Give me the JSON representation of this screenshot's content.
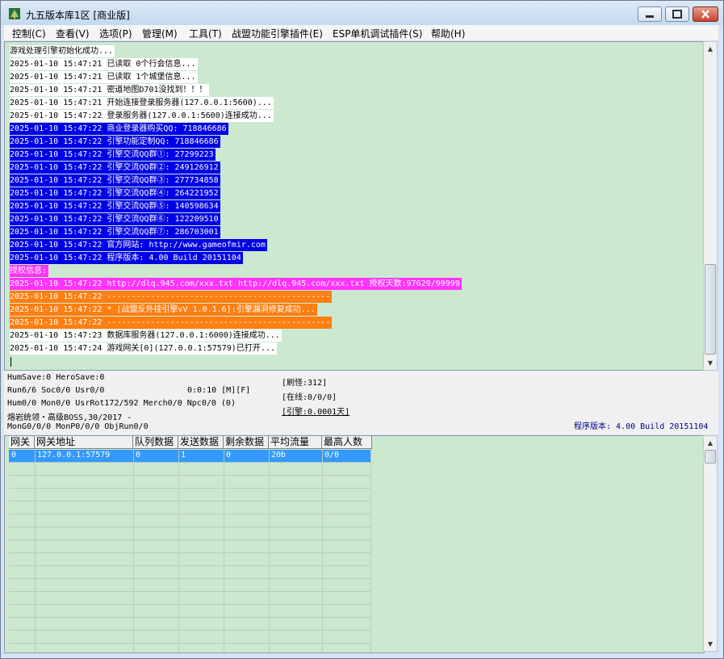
{
  "window": {
    "title": "九五版本库1区 [商业版]",
    "buttons": [
      "minimize-icon",
      "maximize-icon",
      "close-icon"
    ]
  },
  "menu": [
    "控制(C)",
    "查看(V)",
    "选项(P)",
    "管理(M)",
    "工具(T)",
    "战盟功能引擎插件(E)",
    "ESP单机调试插件(S)",
    "帮助(H)"
  ],
  "log": [
    {
      "text": "游戏处理引擎初始化成功...",
      "style": "white"
    },
    {
      "text": "2025-01-10 15:47:21 已读取 0个行会信息...",
      "style": "white"
    },
    {
      "text": "2025-01-10 15:47:21 已读取 1个城堡信息...",
      "style": "white"
    },
    {
      "text": "2025-01-10 15:47:21 密道地图D701没找到！！！",
      "style": "white"
    },
    {
      "text": "2025-01-10 15:47:21 开始连接登录服务器(127.0.0.1:5600)...",
      "style": "white"
    },
    {
      "text": "2025-01-10 15:47:22 登录服务器(127.0.0.1:5600)连接成功...",
      "style": "white"
    },
    {
      "text": "2025-01-10 15:47:22 商业登录器购买QQ: 718846686",
      "style": "blue"
    },
    {
      "text": "2025-01-10 15:47:22 引擎功能定制QQ: 718846686",
      "style": "blue"
    },
    {
      "text": "2025-01-10 15:47:22 引擎交流QQ群①: 27299223",
      "style": "blue"
    },
    {
      "text": "2025-01-10 15:47:22 引擎交流QQ群②: 249126912",
      "style": "blue"
    },
    {
      "text": "2025-01-10 15:47:22 引擎交流QQ群③: 277734858",
      "style": "blue"
    },
    {
      "text": "2025-01-10 15:47:22 引擎交流QQ群④: 264221952",
      "style": "blue"
    },
    {
      "text": "2025-01-10 15:47:22 引擎交流QQ群⑤: 140598634",
      "style": "blue"
    },
    {
      "text": "2025-01-10 15:47:22 引擎交流QQ群⑥: 122209510",
      "style": "blue"
    },
    {
      "text": "2025-01-10 15:47:22 引擎交流QQ群⑦: 286703001",
      "style": "blue"
    },
    {
      "text": "2025-01-10 15:47:22 官方网站: http://www.gameofmir.com",
      "style": "blue"
    },
    {
      "text": "2025-01-10 15:47:22 程序版本: 4.00 Build 20151104",
      "style": "blue"
    },
    {
      "text": "授权信息:",
      "style": "magenta"
    },
    {
      "text": "2025-01-10 15:47:22 http://dlq.945.com/xxx.txt http://dlq.945.com/xxx.txt 授权天数:97629/99999",
      "style": "magenta"
    },
    {
      "text": "2025-01-10 15:47:22 ----------------------------------------------",
      "style": "orange"
    },
    {
      "text": "2025-01-10 15:47:22 * [战盟反外挂引擎vV 1.0.1.6]:引擎漏洞修复成功...",
      "style": "orange"
    },
    {
      "text": "2025-01-10 15:47:22 ----------------------------------------------",
      "style": "orange"
    },
    {
      "text": "2025-01-10 15:47:23 数据库服务器(127.0.0.1:6000)连接成功...",
      "style": "white"
    },
    {
      "text": "2025-01-10 15:47:24 游戏网关[0](127.0.0.1:57579)已打开...",
      "style": "white"
    }
  ],
  "status": {
    "line1": "HumSave:0 HeroSave:0",
    "line2a": "Run6/6 Soc0/0 Usr0/0",
    "line2b": "0:0:10 [M][F]",
    "line3": "Hum0/0 Mon0/0 UsrRot172/592 Merch0/0 Npc0/0 (0)",
    "line4": "熔岩统领・高级BOSS,30/2017 -",
    "line5": "MonG0/0/0 MonP0/0/0 ObjRun0/0",
    "refresh": "[刷怪:312]",
    "online": "[在线:0/0/0]",
    "engine": "[引擎:0.0001天]",
    "version": "程序版本: 4.00 Build 20151104"
  },
  "grid": {
    "headers": [
      "网关",
      "网关地址",
      "队列数据",
      "发送数据",
      "剩余数据",
      "平均流量",
      "最高人数"
    ],
    "rows": [
      [
        "0",
        "127.0.0.1:57579",
        "0",
        "1",
        "0",
        "20b",
        "0/0"
      ]
    ]
  }
}
